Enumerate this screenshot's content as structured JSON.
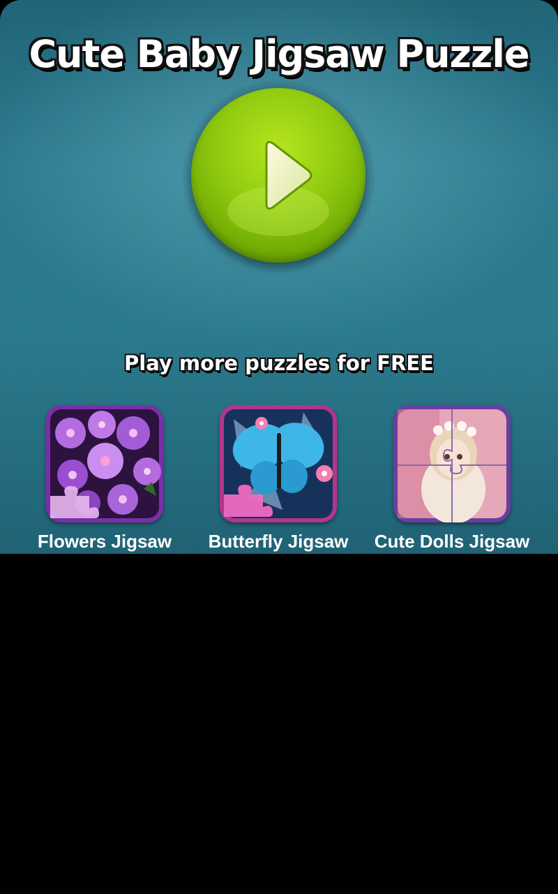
{
  "app": {
    "title": "Cute Baby Jigsaw Puzzle",
    "play_button_icon": "play-icon"
  },
  "promo": {
    "heading": "Play more puzzles for FREE",
    "games": [
      {
        "label": "Flowers Jigsaw",
        "icon": "flowers-puzzle-icon",
        "frame_color": "#7a2fa8"
      },
      {
        "label": "Butterfly Jigsaw",
        "icon": "butterfly-puzzle-icon",
        "frame_color": "#b0368e"
      },
      {
        "label": "Cute Dolls Jigsaw",
        "icon": "doll-puzzle-icon",
        "frame_color": "#6a3ea0"
      }
    ]
  },
  "colors": {
    "background": "#2a7a8e",
    "play_button": "#8fc80f",
    "text": "#ffffff"
  }
}
